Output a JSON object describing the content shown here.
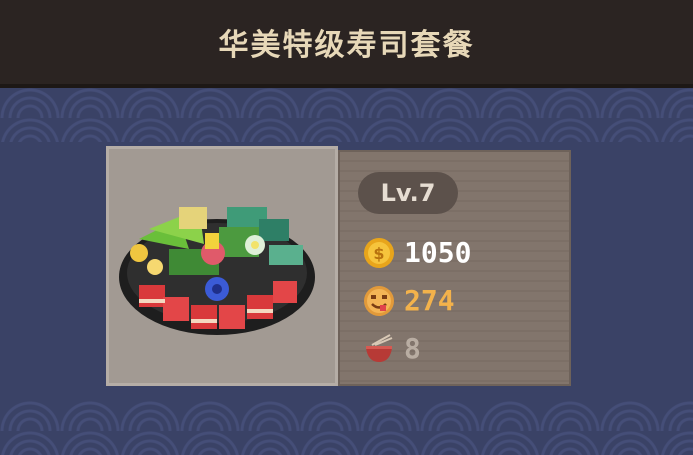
{
  "header": {
    "title": "华美特级寿司套餐"
  },
  "card": {
    "level": "Lv.7",
    "stats": {
      "coin": "1050",
      "taste": "274",
      "bowl": "8"
    }
  },
  "icons": {
    "coin": "coin-icon",
    "taste": "taste-face-icon",
    "bowl": "noodle-bowl-icon",
    "dish": "sushi-platter-image"
  },
  "colors": {
    "background": "#3a4266",
    "header": "#2b2422",
    "title": "#e7d8b8",
    "coin_value": "#ffffff",
    "taste_value": "#f3b24b",
    "bowl_value": "#b9ada2"
  }
}
